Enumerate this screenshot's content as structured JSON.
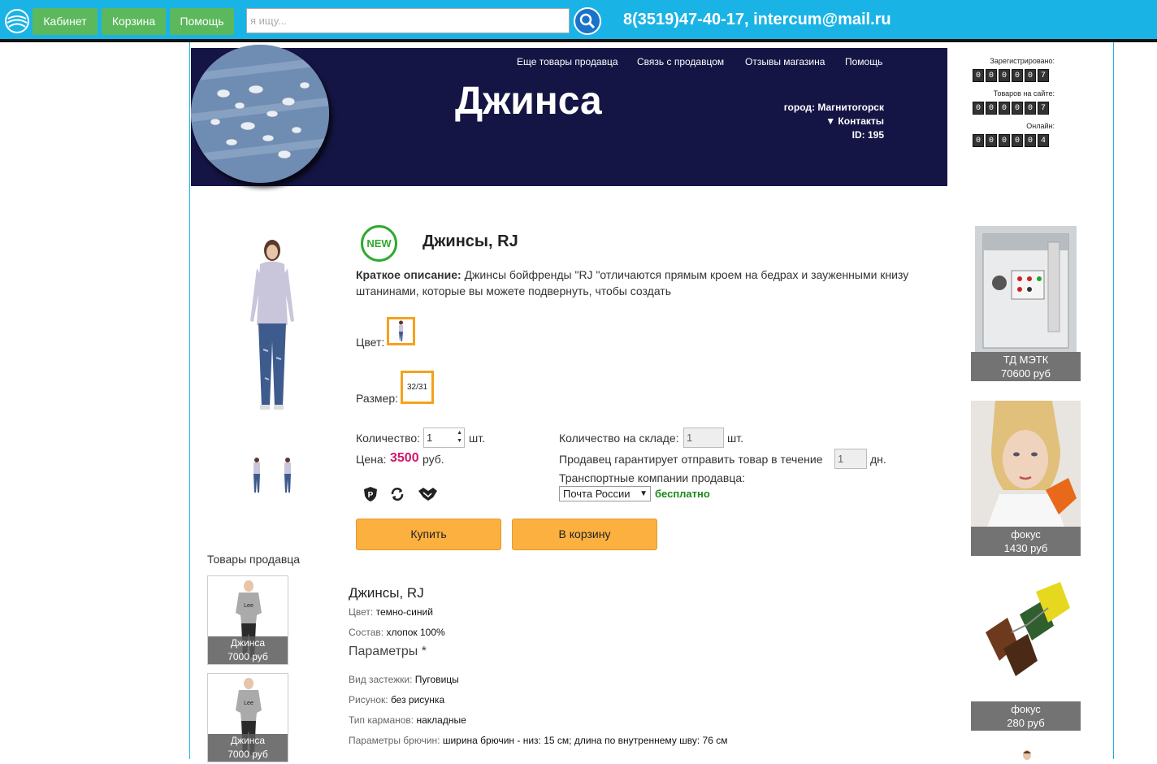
{
  "topbar": {
    "nav": [
      "Кабинет",
      "Корзина",
      "Помощь"
    ],
    "search_placeholder": "я ищу...",
    "contacts": "8(3519)47-40-17, intercum@mail.ru"
  },
  "banner": {
    "nav": [
      "Еще товары продавца",
      "Связь с продавцом",
      "Отзывы магазина",
      "Помощь"
    ],
    "shop_title": "Джинса",
    "city": "город: Магнитогорск",
    "contacts": "▼ Контакты",
    "id": "ID: 195"
  },
  "counters": [
    {
      "label": "Зарегистрировано:",
      "digits": "000007"
    },
    {
      "label": "Товаров на сайте:",
      "digits": "000007"
    },
    {
      "label": "Онлайн:",
      "digits": "000004"
    }
  ],
  "product": {
    "badge": "NEW",
    "title": "Джинсы, RJ",
    "short_desc_label": "Краткое описание:",
    "short_desc_line1": "Джинсы бойфренды \"RJ \"отличаются прямым кроем на бедрах и зауженными книзу",
    "short_desc_line2": "штанинами, которые вы можете подвернуть, чтобы создать",
    "color_label": "Цвет:",
    "size_label": "Размер:",
    "size_value": "32/31",
    "qty_label": "Количество:",
    "qty_value": "1",
    "qty_unit": "шт.",
    "price_label": "Цена:",
    "price_value": "3500",
    "price_unit": "руб.",
    "stock_label": "Количество на складе:",
    "stock_value": "1",
    "stock_unit": "шт.",
    "guarantee_label": "Продавец гарантирует отправить товар в течение",
    "guarantee_value": "1",
    "guarantee_unit": "дн.",
    "transport_label": "Транспортные компании продавца:",
    "transport_selected": "Почта России",
    "transport_free": "бесплатно",
    "buy_label": "Купить",
    "cart_label": "В корзину"
  },
  "seller_goods": {
    "title": "Товары продавца",
    "items": [
      {
        "name": "Джинса",
        "price": "7000 руб"
      },
      {
        "name": "Джинса",
        "price": "7000 руб"
      }
    ]
  },
  "details": {
    "title": "Джинсы, RJ",
    "color_label": "Цвет:",
    "color_value": "темно-синий",
    "composition_label": "Состав:",
    "composition_value": "хлопок 100%",
    "params_title": "Параметры *",
    "fastener_label": "Вид застежки:",
    "fastener_value": "Пуговицы",
    "pattern_label": "Рисунок:",
    "pattern_value": "без рисунка",
    "pockets_label": "Тип карманов:",
    "pockets_value": "накладные",
    "trousers_label": "Параметры брючин:",
    "trousers_value": "ширина брючин - низ: 15 см; длина по внутреннему шву: 76 см"
  },
  "sidebar": [
    {
      "name": "ТД МЭТК",
      "price": "70600 руб"
    },
    {
      "name": "фокус",
      "price": "1430 руб"
    },
    {
      "name": "фокус",
      "price": "280 руб"
    }
  ]
}
